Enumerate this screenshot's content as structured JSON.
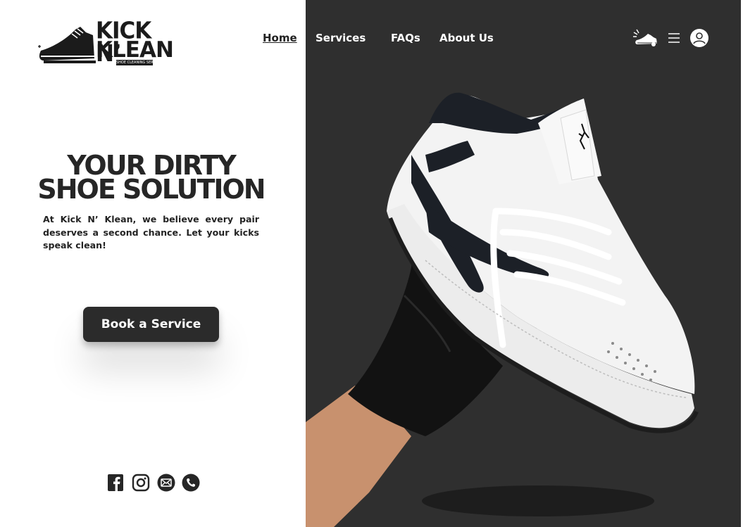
{
  "brand": {
    "logo_line1": "KICK N’",
    "logo_line2": "KLEAN",
    "logo_tagline": "SHOE CLEANING SERVICES"
  },
  "nav": {
    "items": [
      {
        "label": "Home",
        "active": true
      },
      {
        "label": "Services",
        "active": false
      },
      {
        "label": "FAQs",
        "active": false
      },
      {
        "label": "About Us",
        "active": false
      }
    ]
  },
  "header_icons": [
    "shoe-cleaning-icon",
    "hamburger-menu-icon",
    "user-avatar-icon"
  ],
  "hero": {
    "title_line1": "YOUR DIRTY",
    "title_line2": "SHOE SOLUTION",
    "description": "At Kick N’ Klean, we believe every pair deserves a second chance. Let your kicks speak clean!",
    "cta_label": "Book a Service"
  },
  "social_icons": [
    "facebook-icon",
    "instagram-icon",
    "email-icon",
    "phone-icon"
  ],
  "colors": {
    "dark_panel": "#2f2f2f",
    "text_dark": "#262626",
    "button_bg": "#2b2b2b",
    "white": "#ffffff"
  }
}
